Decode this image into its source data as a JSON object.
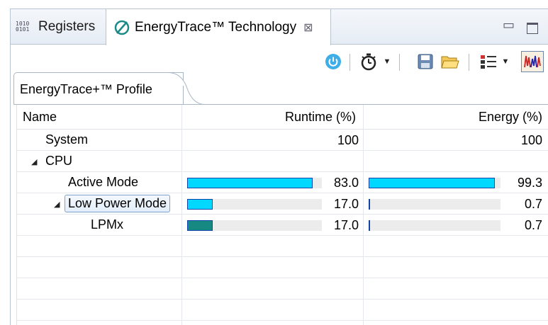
{
  "tabs": [
    {
      "label": "Registers",
      "icon": "registers-binary-icon",
      "icon_text": "1010\n0101"
    },
    {
      "label": "EnergyTrace™ Technology",
      "icon": "energytrace-icon",
      "active": true
    }
  ],
  "profile_tab": {
    "label": "EnergyTrace+™ Profile"
  },
  "columns": [
    "Name",
    "Runtime (%)",
    "Energy (%)"
  ],
  "rows": [
    {
      "name": "System",
      "depth": 0,
      "expander": "",
      "runtime": "100",
      "energy": "100",
      "runtime_frac": null,
      "energy_frac": null
    },
    {
      "name": "CPU",
      "depth": 0,
      "expander": "◢",
      "runtime": "",
      "energy": "",
      "runtime_frac": null,
      "energy_frac": null
    },
    {
      "name": "Active Mode",
      "depth": 1,
      "expander": "",
      "runtime": "83.0",
      "energy": "99.3",
      "runtime_frac": 0.83,
      "energy_frac": 0.993,
      "fill_color": "#00d8ff"
    },
    {
      "name": "Low Power Mode",
      "depth": 1,
      "expander": "◢",
      "selected": true,
      "runtime": "17.0",
      "energy": "0.7",
      "runtime_frac": 0.17,
      "energy_frac": 0.007,
      "fill_color": "#00d8ff"
    },
    {
      "name": "LPMx",
      "depth": 2,
      "expander": "",
      "runtime": "17.0",
      "energy": "0.7",
      "runtime_frac": 0.17,
      "energy_frac": 0.007,
      "fill_color": "#168a82"
    }
  ],
  "empty_rows": 4,
  "colors": {
    "accent_cyan": "#00d8ff",
    "lpm_teal": "#168a82",
    "bar_border": "#1144aa",
    "bar_track": "#ececec"
  }
}
